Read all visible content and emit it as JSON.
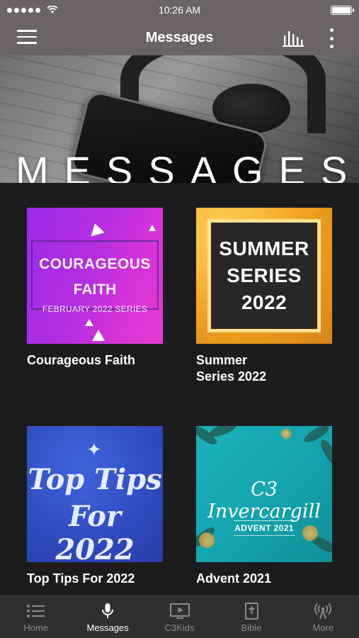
{
  "status_bar": {
    "time": "10:26 AM"
  },
  "nav": {
    "title": "Messages"
  },
  "hero": {
    "title": "MESSAGES"
  },
  "cards": [
    {
      "title": "Courageous Faith",
      "art": {
        "line1": "COURAGEOUS",
        "line2": "FAITH",
        "line3": "FEBRUARY 2022 SERIES"
      }
    },
    {
      "title": "Summer\nSeries 2022",
      "art": {
        "line1": "SUMMER",
        "line2": "SERIES",
        "line3": "2022"
      }
    },
    {
      "title": "Top Tips For 2022",
      "art": {
        "line1": "Top Tips",
        "line2": "For 2022"
      }
    },
    {
      "title": "Advent 2021",
      "art": {
        "line1": "C3 Invercargill",
        "line2": "ADVENT 2021"
      }
    }
  ],
  "tabs": [
    {
      "label": "Home",
      "icon": "list-icon",
      "active": false
    },
    {
      "label": "Messages",
      "icon": "microphone-icon",
      "active": true
    },
    {
      "label": "C3Kids",
      "icon": "tv-play-icon",
      "active": false
    },
    {
      "label": "Bible",
      "icon": "bible-icon",
      "active": false
    },
    {
      "label": "More",
      "icon": "broadcast-icon",
      "active": false
    }
  ],
  "colors": {
    "bar": "#6b6364",
    "background": "#1c1c1e",
    "tab_inactive": "#8b8b8f",
    "tab_active": "#ffffff"
  }
}
